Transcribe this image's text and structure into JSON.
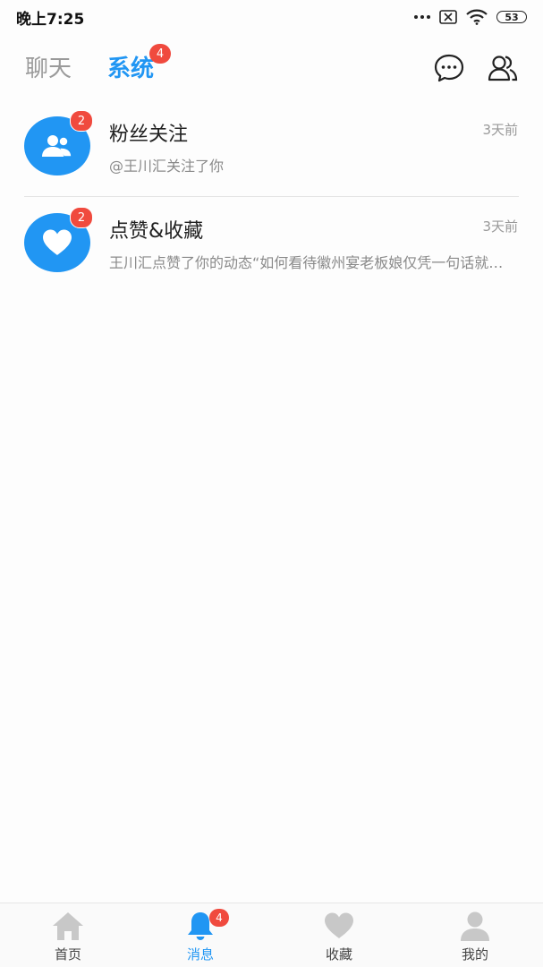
{
  "status_bar": {
    "time": "晚上7:25",
    "battery": "53"
  },
  "header": {
    "tabs": [
      {
        "label": "聊天",
        "active": false
      },
      {
        "label": "系统",
        "active": true,
        "badge": "4"
      }
    ],
    "icons": [
      "chat-bubble-icon",
      "contacts-icon"
    ]
  },
  "list": {
    "items": [
      {
        "title": "粉丝关注",
        "subtitle": "@王川汇关注了你",
        "time": "3天前",
        "badge": "2",
        "icon": "users-icon"
      },
      {
        "title": "点赞&收藏",
        "subtitle": "王川汇点赞了你的动态“如何看待徽州宴老板娘仅凭一句话就…",
        "time": "3天前",
        "badge": "2",
        "icon": "heart-icon"
      }
    ]
  },
  "bottom_nav": {
    "items": [
      {
        "label": "首页",
        "icon": "home-icon",
        "active": false
      },
      {
        "label": "消息",
        "icon": "bell-icon",
        "active": true,
        "badge": "4"
      },
      {
        "label": "收藏",
        "icon": "heart-icon",
        "active": false
      },
      {
        "label": "我的",
        "icon": "person-icon",
        "active": false
      }
    ]
  },
  "colors": {
    "accent": "#2196f3",
    "badge": "#f04a3e",
    "inactive_icon": "#c8c8c8"
  }
}
